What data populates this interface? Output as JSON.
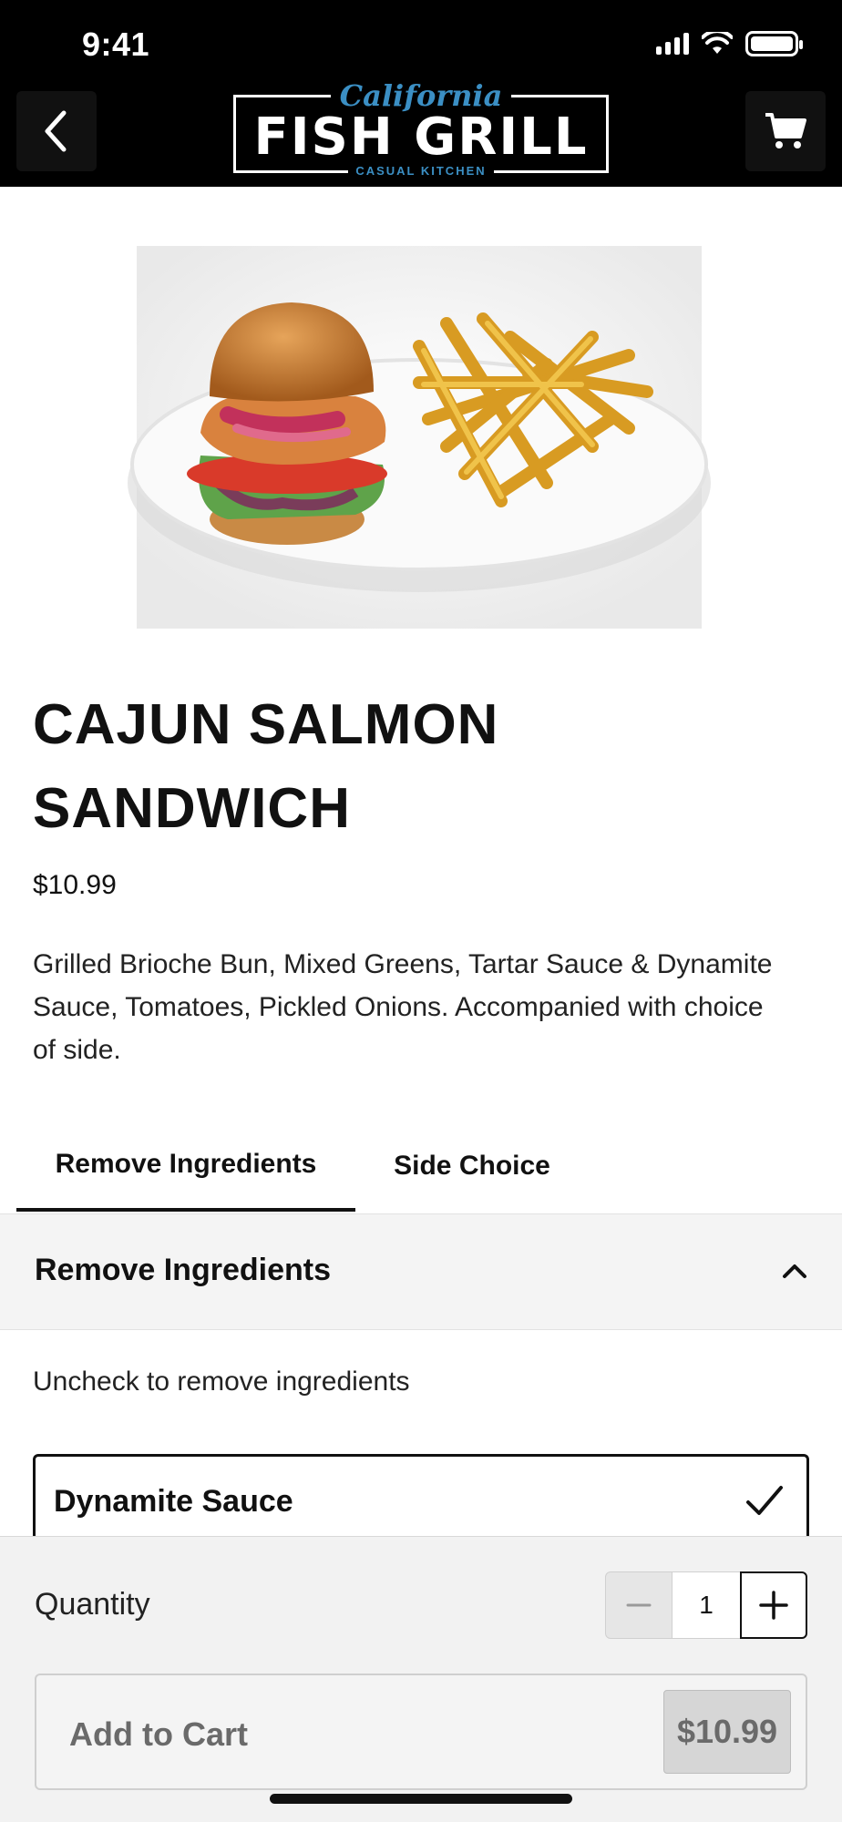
{
  "status_bar": {
    "time": "9:41"
  },
  "header": {
    "logo_script": "California",
    "logo_main": "FISH GRILL",
    "logo_sub": "CASUAL KITCHEN"
  },
  "product": {
    "title": "CAJUN SALMON SANDWICH",
    "price": "$10.99",
    "description": "Grilled Brioche Bun, Mixed Greens, Tartar Sauce & Dynamite Sauce, Tomatoes, Pickled Onions. Accompanied with choice of side."
  },
  "tabs": [
    {
      "label": "Remove Ingredients",
      "active": true
    },
    {
      "label": "Side Choice",
      "active": false
    }
  ],
  "accordion": {
    "title": "Remove Ingredients",
    "expanded": true
  },
  "hint": "Uncheck to remove ingredients",
  "options": [
    {
      "label": "Dynamite Sauce",
      "checked": true
    }
  ],
  "footer": {
    "quantity_label": "Quantity",
    "quantity_value": "1",
    "add_to_cart_label": "Add to Cart",
    "total_price": "$10.99"
  },
  "colors": {
    "header_bg": "#000000",
    "logo_accent": "#3b8fc4",
    "sheet_bg": "#f2f2f2"
  },
  "icons": [
    "back-arrow-icon",
    "cart-icon",
    "chevron-up-icon",
    "checkmark-icon",
    "minus-icon",
    "plus-icon",
    "signal-icon",
    "wifi-icon",
    "battery-icon"
  ]
}
